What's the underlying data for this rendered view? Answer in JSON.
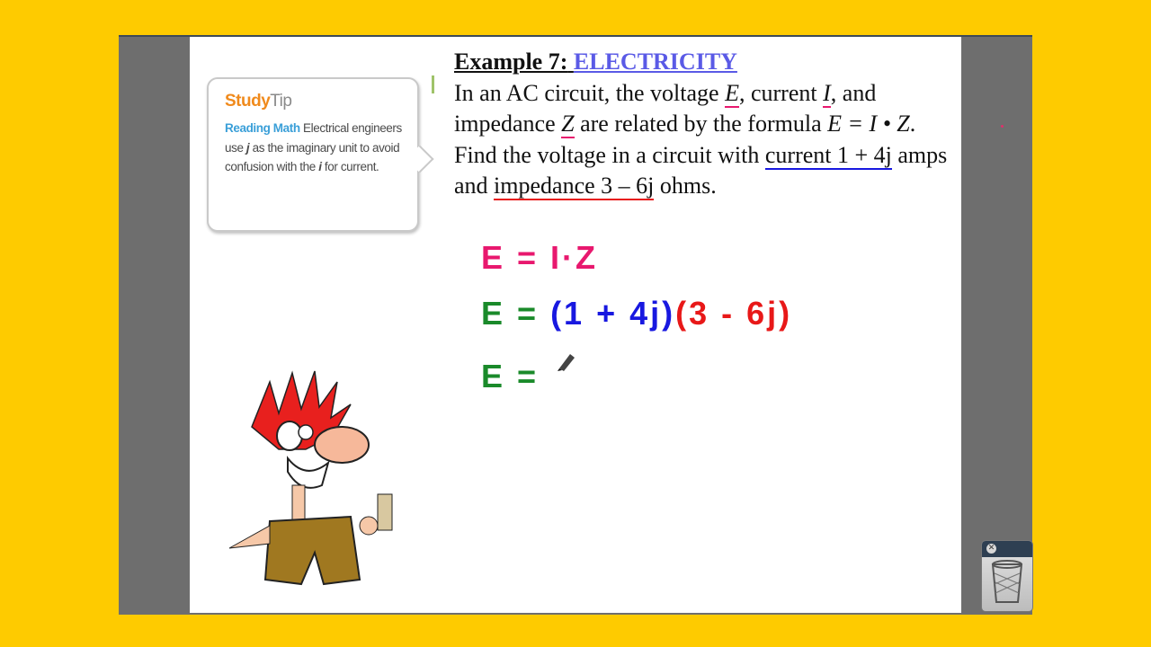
{
  "study_tip": {
    "title_strong": "Study",
    "title_light": "Tip",
    "label": "Reading Math",
    "body_1": " Electrical engineers use ",
    "j": "j",
    "body_2": " as the imaginary unit to avoid confusion with the ",
    "i": "i",
    "body_3": " for current."
  },
  "problem": {
    "title_prefix": "Example 7:",
    "title_topic": "ELECTRICITY",
    "t1": "In an AC circuit, the voltage ",
    "E": "E",
    "t2": ", current ",
    "I": "I",
    "t3": ", and impedance ",
    "Z": "Z",
    "t4": " are related by the formula ",
    "formula": "E = I • Z",
    "t5": ".  Find the voltage in a circuit with ",
    "current": "current 1 + 4j",
    "t6": " amps and ",
    "impedance": "impedance 3 – 6j",
    "t7": " ohms."
  },
  "handwriting": {
    "line1": "E = I·Z",
    "line2_left": "E =",
    "line2_blue": "(1 + 4j)",
    "line2_red": "(3 - 6j)",
    "line3": "E ="
  },
  "colors": {
    "background": "#fecb00",
    "pink_ink": "#e8186e",
    "green_ink": "#1a8a2a",
    "blue_ink": "#1818e0",
    "red_ink": "#e81818"
  },
  "icons": {
    "trash": "trash-icon",
    "close": "close-icon",
    "pen": "pen-cursor-icon"
  }
}
